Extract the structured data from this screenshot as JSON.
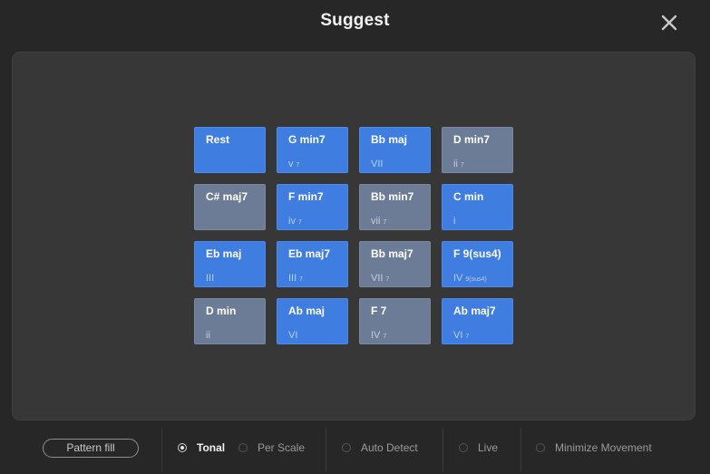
{
  "dialog": {
    "title": "Suggest",
    "close_icon": "close-icon"
  },
  "chords": [
    {
      "name": "Rest",
      "degree": "",
      "ext": "",
      "style": "blue"
    },
    {
      "name": "G min7",
      "degree": "v",
      "ext": "7",
      "style": "blue"
    },
    {
      "name": "Bb maj",
      "degree": "VII",
      "ext": "",
      "style": "blue"
    },
    {
      "name": "D min7",
      "degree": "ii",
      "ext": "7",
      "style": "gray"
    },
    {
      "name": "C# maj7",
      "degree": "",
      "ext": "",
      "style": "gray"
    },
    {
      "name": "F min7",
      "degree": "iv",
      "ext": "7",
      "style": "blue"
    },
    {
      "name": "Bb min7",
      "degree": "vii",
      "ext": "7",
      "style": "gray"
    },
    {
      "name": "C min",
      "degree": "i",
      "ext": "",
      "style": "blue"
    },
    {
      "name": "Eb maj",
      "degree": "III",
      "ext": "",
      "style": "blue"
    },
    {
      "name": "Eb maj7",
      "degree": "III",
      "ext": "7",
      "style": "blue"
    },
    {
      "name": "Bb maj7",
      "degree": "VII",
      "ext": "7",
      "style": "gray"
    },
    {
      "name": "F 9(sus4)",
      "degree": "IV",
      "ext": "9(sus4)",
      "style": "blue"
    },
    {
      "name": "D min",
      "degree": "ii",
      "ext": "",
      "style": "gray"
    },
    {
      "name": "Ab maj",
      "degree": "VI",
      "ext": "",
      "style": "blue"
    },
    {
      "name": "F 7",
      "degree": "IV",
      "ext": "7",
      "style": "gray"
    },
    {
      "name": "Ab maj7",
      "degree": "VI",
      "ext": "7",
      "style": "blue"
    }
  ],
  "footer": {
    "pattern_fill": "Pattern fill",
    "options": [
      {
        "label": "Tonal",
        "selected": true
      },
      {
        "label": "Per Scale",
        "selected": false
      },
      {
        "label": "Auto Detect",
        "selected": false
      },
      {
        "label": "Live",
        "selected": false
      },
      {
        "label": "Minimize Movement",
        "selected": false
      }
    ]
  },
  "colors": {
    "accent_blue": "#3f7ee0",
    "muted_gray": "#6d7c96",
    "background": "#272727",
    "panel": "#373737"
  }
}
